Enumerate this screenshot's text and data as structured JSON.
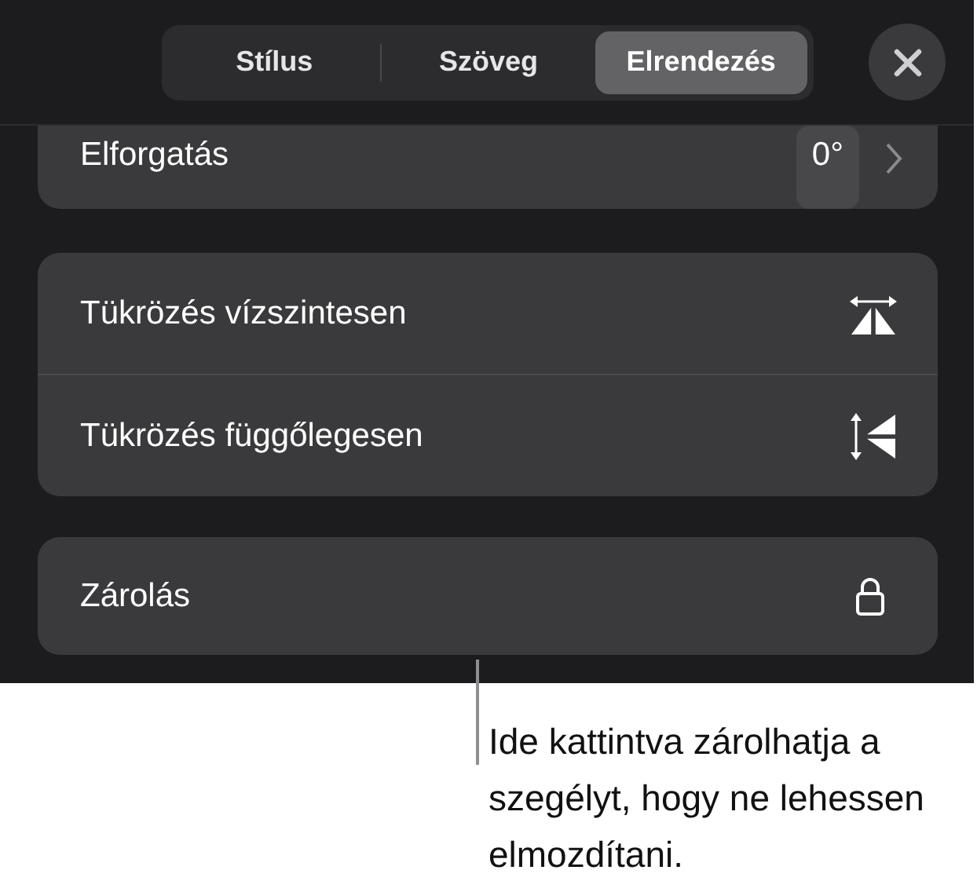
{
  "tabs": [
    {
      "label": "Stílus",
      "selected": false
    },
    {
      "label": "Szöveg",
      "selected": false
    },
    {
      "label": "Elrendezés",
      "selected": true
    }
  ],
  "rotation": {
    "label": "Elforgatás",
    "value": "0°"
  },
  "mirror_rows": [
    {
      "label": "Tükrözés vízszintesen",
      "kind": "horizontal"
    },
    {
      "label": "Tükrözés függőlegesen",
      "kind": "vertical"
    }
  ],
  "lock_row": {
    "label": "Zárolás"
  },
  "callout": "Ide kattintva zárolhatja a szegélyt, hogy ne lehessen elmozdítani."
}
